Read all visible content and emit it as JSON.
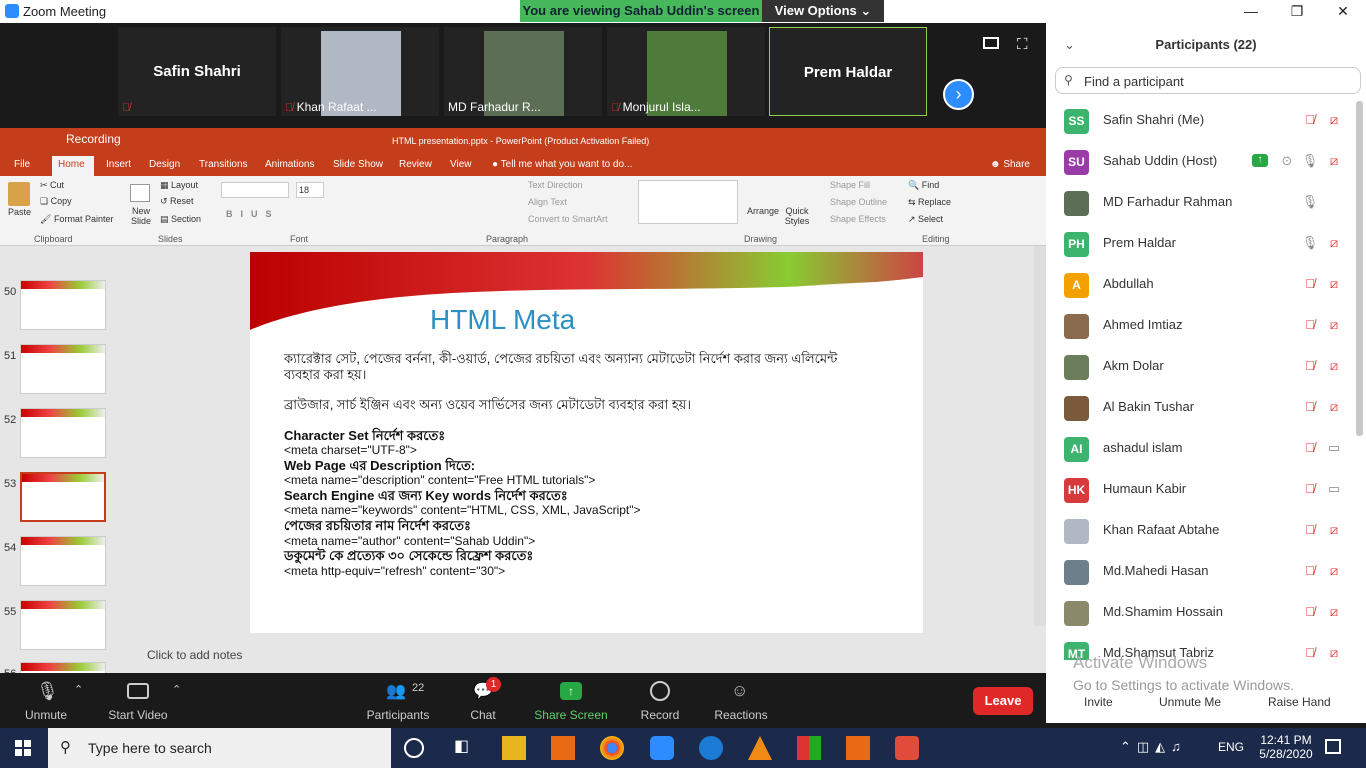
{
  "window": {
    "title": "Zoom Meeting",
    "banner": "You are viewing Sahab Uddin's screen",
    "view_options": "View Options"
  },
  "gallery": {
    "tiles": [
      {
        "name": "Safin Shahri",
        "label": "",
        "type": "name"
      },
      {
        "name": "",
        "label": "Khan Rafaat ...",
        "type": "photo",
        "color": "#b0b8c4"
      },
      {
        "name": "",
        "label": "MD Farhadur R...",
        "type": "photo",
        "color": "#5d6e57"
      },
      {
        "name": "",
        "label": "Monjurul Isla...",
        "type": "photo",
        "color": "#4e7a3b"
      },
      {
        "name": "Prem Haldar",
        "label": "",
        "type": "name"
      }
    ]
  },
  "ppt": {
    "recording": "Recording",
    "file_title": "HTML presentation.pptx - PowerPoint (Product Activation Failed)",
    "tabs": [
      "File",
      "Home",
      "Insert",
      "Design",
      "Transitions",
      "Animations",
      "Slide Show",
      "Review",
      "View"
    ],
    "tell_me": "Tell me what you want to do...",
    "share": "Share",
    "ribbon": {
      "paste": "Paste",
      "cut": "Cut",
      "copy": "Copy",
      "format_painter": "Format Painter",
      "clipboard": "Clipboard",
      "new_slide": "New Slide",
      "layout": "Layout",
      "reset": "Reset",
      "section": "Section",
      "slides": "Slides",
      "font_size": "18",
      "font": "Font",
      "paragraph": "Paragraph",
      "text_direction": "Text Direction",
      "align_text": "Align Text",
      "convert_smartart": "Convert to SmartArt",
      "arrange": "Arrange",
      "quick_styles": "Quick Styles",
      "shape_fill": "Shape Fill",
      "shape_outline": "Shape Outline",
      "shape_effects": "Shape Effects",
      "drawing": "Drawing",
      "find": "Find",
      "replace": "Replace",
      "select": "Select",
      "editing": "Editing"
    },
    "thumbs": [
      {
        "n": "50"
      },
      {
        "n": "51"
      },
      {
        "n": "52"
      },
      {
        "n": "53",
        "selected": true
      },
      {
        "n": "54"
      },
      {
        "n": "55"
      },
      {
        "n": "56"
      }
    ],
    "slide": {
      "title": "HTML Meta",
      "p1a": "ক্যারেক্টার সেট, পেজের বর্ননা, কী-ওয়ার্ড, পেজের রচয়িতা এবং অন্যান্য মেটাডেটা নির্দেশ করার জন্য এলিমেন্ট",
      "p1b": "ব্যবহার করা হয়।",
      "p2": "ব্রাউজার, সার্চ ইঞ্জিন এবং অন্য ওয়েব সার্ভিসের জন্য মেটাডেটা ব্যবহার করা হয়।",
      "l1": "Character Set নির্দেশ করতেঃ",
      "l2": "<meta charset=\"UTF-8\">",
      "l3": "Web Page এর Description দিতে:",
      "l4": "<meta name=\"description\" content=\"Free HTML tutorials\">",
      "l5": "Search Engine এর জন্য Key words নির্দেশ করতেঃ",
      "l6": "<meta name=\"keywords\" content=\"HTML, CSS, XML, JavaScript\">",
      "l7": "পেজের রচয়িতার নাম নির্দেশ করতেঃ",
      "l8": "<meta name=\"author\" content=\"Sahab Uddin\">",
      "l9": "ডকুমেন্ট কে প্রত্যেক ৩০ সেকেন্ডে রিফ্রেশ করতেঃ",
      "l10": "<meta http-equiv=\"refresh\" content=\"30\">"
    },
    "notes": "Click to add notes"
  },
  "participants": {
    "header": "Participants (22)",
    "search_placeholder": "Find a participant",
    "list": [
      {
        "initials": "SS",
        "name": "Safin Shahri (Me)",
        "color": "#3cb46e",
        "mic": "muted",
        "video": "off"
      },
      {
        "initials": "SU",
        "name": "Sahab Uddin (Host)",
        "color": "#9b3ba8",
        "mic": "on",
        "video": "off",
        "sharing": true
      },
      {
        "initials": "",
        "name": "MD Farhadur Rahman",
        "color": "#5d6e57",
        "mic": "on",
        "video": "none"
      },
      {
        "initials": "PH",
        "name": "Prem Haldar",
        "color": "#3cb46e",
        "mic": "on",
        "video": "off"
      },
      {
        "initials": "A",
        "name": "Abdullah",
        "color": "#f2a100",
        "mic": "muted",
        "video": "off"
      },
      {
        "initials": "",
        "name": "Ahmed Imtiaz",
        "color": "#8a6b4e",
        "mic": "muted",
        "video": "off"
      },
      {
        "initials": "",
        "name": "Akm Dolar",
        "color": "#6b7d5b",
        "mic": "muted",
        "video": "off"
      },
      {
        "initials": "",
        "name": "Al Bakin Tushar",
        "color": "#7a5a3a",
        "mic": "muted",
        "video": "off"
      },
      {
        "initials": "AI",
        "name": "ashadul islam",
        "color": "#3cb46e",
        "mic": "muted",
        "video": "on"
      },
      {
        "initials": "HK",
        "name": "Humaun Kabir",
        "color": "#d73a3a",
        "mic": "muted",
        "video": "on"
      },
      {
        "initials": "",
        "name": "Khan Rafaat Abtahe",
        "color": "#b0b8c4",
        "mic": "muted",
        "video": "off"
      },
      {
        "initials": "",
        "name": "Md.Mahedi Hasan",
        "color": "#6d7f8a",
        "mic": "muted",
        "video": "off"
      },
      {
        "initials": "",
        "name": "Md.Shamim Hossain",
        "color": "#8a8a6a",
        "mic": "muted",
        "video": "off"
      },
      {
        "initials": "MT",
        "name": "Md.Shamsut Tabriz",
        "color": "#3cb46e",
        "mic": "muted",
        "video": "off"
      }
    ],
    "invite": "Invite",
    "unmute_me": "Unmute Me",
    "raise_hand": "Raise Hand",
    "activate_title": "Activate Windows",
    "activate_sub": "Go to Settings to activate Windows."
  },
  "controls": {
    "unmute": "Unmute",
    "start_video": "Start Video",
    "participants": "Participants",
    "participants_count": "22",
    "chat": "Chat",
    "chat_badge": "1",
    "share_screen": "Share Screen",
    "record": "Record",
    "reactions": "Reactions",
    "leave": "Leave"
  },
  "taskbar": {
    "search_placeholder": "Type here to search",
    "lang": "ENG",
    "time": "12:41 PM",
    "date": "5/28/2020"
  }
}
